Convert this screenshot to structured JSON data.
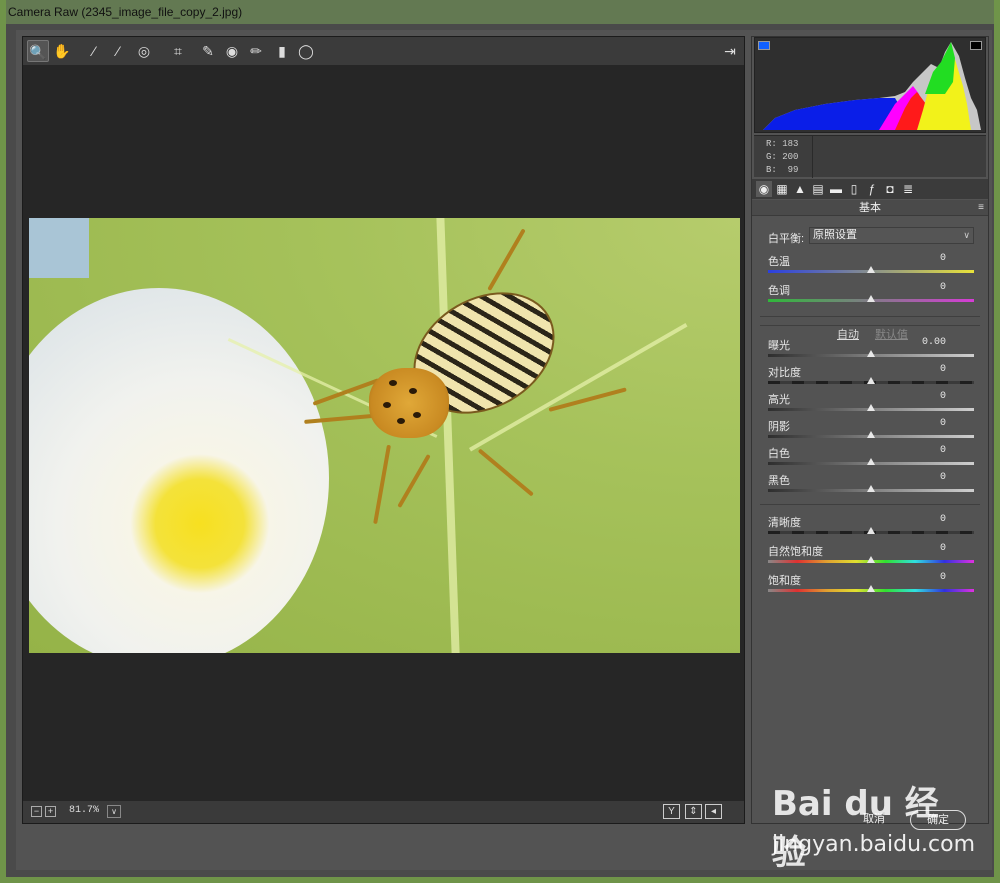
{
  "window": {
    "title": "Camera Raw (2345_image_file_copy_2.jpg)"
  },
  "toolbar": {
    "tools": [
      {
        "name": "zoom-tool-icon",
        "glyph": "🔍"
      },
      {
        "name": "hand-tool-icon",
        "glyph": "✋"
      },
      {
        "name": "white-balance-tool-icon",
        "glyph": "⁄"
      },
      {
        "name": "color-sampler-tool-icon",
        "glyph": "⁄"
      },
      {
        "name": "targeted-adjustment-tool-icon",
        "glyph": "◎"
      },
      {
        "name": "crop-tool-icon",
        "glyph": "⌗"
      },
      {
        "name": "spot-removal-tool-icon",
        "glyph": "✎"
      },
      {
        "name": "red-eye-tool-icon",
        "glyph": "◉"
      },
      {
        "name": "adjustment-brush-icon",
        "glyph": "✏"
      },
      {
        "name": "graduated-filter-icon",
        "glyph": "▮"
      },
      {
        "name": "radial-filter-icon",
        "glyph": "◯"
      }
    ],
    "export_icon": "⇥"
  },
  "status": {
    "zoom_out": "−",
    "zoom_in": "+",
    "zoom_level": "81.7%",
    "zoom_dropdown": "∨",
    "view_y": "Y",
    "view_swap": "⇕",
    "view_copy": "◂"
  },
  "rgb": {
    "r_label": "R:",
    "r": "183",
    "g_label": "G:",
    "g": "200",
    "b_label": "B:",
    "b": "99"
  },
  "panel": {
    "section_title": "基本",
    "menu": "≡",
    "white_balance_label": "白平衡:",
    "white_balance_value": "原照设置",
    "auto_label": "自动",
    "default_label": "默认值",
    "sliders": [
      {
        "id": "temp",
        "label": "色温",
        "value": "0",
        "level": 0.5,
        "track": "temp"
      },
      {
        "id": "tint",
        "label": "色调",
        "value": "0",
        "level": 0.5,
        "track": "tint"
      },
      {
        "id": "exposure",
        "label": "曝光",
        "value": "0.00",
        "level": 0.5,
        "track": "gray"
      },
      {
        "id": "contrast",
        "label": "对比度",
        "value": "0",
        "level": 0.5,
        "track": "dark"
      },
      {
        "id": "highlights",
        "label": "高光",
        "value": "0",
        "level": 0.5,
        "track": "gray"
      },
      {
        "id": "shadows",
        "label": "阴影",
        "value": "0",
        "level": 0.5,
        "track": "gray"
      },
      {
        "id": "whites",
        "label": "白色",
        "value": "0",
        "level": 0.5,
        "track": "gray"
      },
      {
        "id": "blacks",
        "label": "黑色",
        "value": "0",
        "level": 0.5,
        "track": "gray"
      },
      {
        "id": "clarity",
        "label": "清晰度",
        "value": "0",
        "level": 0.5,
        "track": "dark"
      },
      {
        "id": "vibrance",
        "label": "自然饱和度",
        "value": "0",
        "level": 0.5,
        "track": "rainbow"
      },
      {
        "id": "saturation",
        "label": "饱和度",
        "value": "0",
        "level": 0.5,
        "track": "rainbow"
      }
    ]
  },
  "buttons": {
    "cancel": "取消",
    "ok": "确定"
  },
  "watermark": {
    "logo": "Bai du 经验",
    "url": "jingyan.baidu.com"
  }
}
